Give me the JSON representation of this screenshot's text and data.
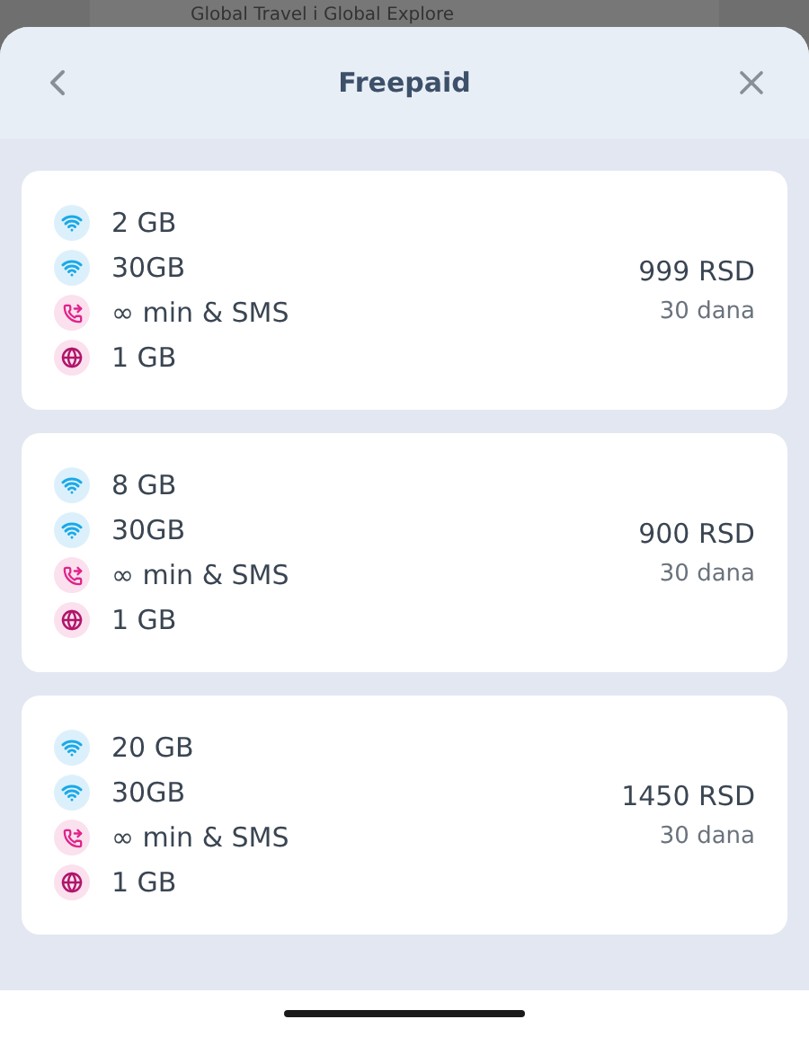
{
  "background": {
    "title": "Global Travel i Global Explore"
  },
  "sheet": {
    "title": "Freepaid"
  },
  "plans": [
    {
      "items": [
        {
          "kind": "data",
          "text": "2 GB"
        },
        {
          "kind": "data",
          "text": "30GB"
        },
        {
          "kind": "call",
          "text": "∞ min & SMS"
        },
        {
          "kind": "roaming",
          "text": "1 GB"
        }
      ],
      "price": "999 RSD",
      "duration": "30 dana"
    },
    {
      "items": [
        {
          "kind": "data",
          "text": "8 GB"
        },
        {
          "kind": "data",
          "text": "30GB"
        },
        {
          "kind": "call",
          "text": "∞ min & SMS"
        },
        {
          "kind": "roaming",
          "text": "1 GB"
        }
      ],
      "price": "900 RSD",
      "duration": "30 dana"
    },
    {
      "items": [
        {
          "kind": "data",
          "text": "20 GB"
        },
        {
          "kind": "data",
          "text": "30GB"
        },
        {
          "kind": "call",
          "text": "∞ min & SMS"
        },
        {
          "kind": "roaming",
          "text": "1 GB"
        }
      ],
      "price": "1450 RSD",
      "duration": "30 dana"
    }
  ]
}
